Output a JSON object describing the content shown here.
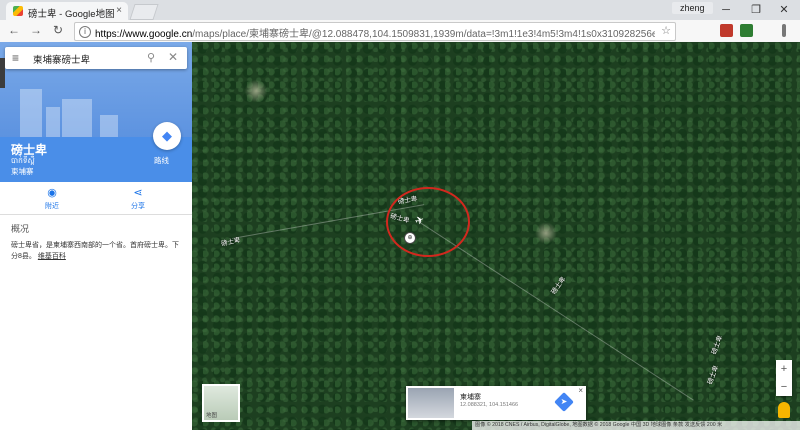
{
  "browser": {
    "tab_title": "磅士卑 - Google地图",
    "tab_close": "×",
    "user": "zheng",
    "win_min": "─",
    "win_max": "❐",
    "win_close": "✕",
    "nav_back": "←",
    "nav_forward": "→",
    "nav_reload": "↻",
    "url_scheme_host": "https://www.google.cn",
    "url_rest": "/maps/place/柬埔寨磅士卑/@12.088478,104.1509831,1939m/data=!3m1!1e3!4m5!3m4!1s0x310928256ebe44a9:0x...",
    "info_icon": "i",
    "star_icon": "☆",
    "ext_colors": [
      "#c0392b",
      "#2e7d32",
      "#777777"
    ]
  },
  "panel": {
    "search_query": "柬埔寨磅士卑",
    "menu_icon": "≡",
    "search_icon": "⚲",
    "clear_icon": "✕",
    "place_name": "磅士卑",
    "place_khmer": "បាក់ទីស្ពឺ",
    "place_country": "柬埔寨",
    "directions_icon": "◆",
    "directions_label": "路线",
    "actions": [
      {
        "icon": "◉",
        "label": "附近"
      },
      {
        "icon": "⋖",
        "label": "分享"
      }
    ],
    "section_heading": "概况",
    "description": "磅士卑省，是柬埔寨西南部的一个省。首府磅士卑。下分8县。",
    "description_link": "维基百科",
    "collapse_icon": "◂"
  },
  "map": {
    "labels": [
      {
        "text": "磅士卑"
      },
      {
        "text": "磅士卑"
      },
      {
        "text": "磅士卑"
      },
      {
        "text": "磅士卑"
      },
      {
        "text": "磅士卑"
      },
      {
        "text": "磅士卑"
      }
    ],
    "pin_icon": "⊕",
    "plane_icon": "✈",
    "minimap_label": "地图",
    "card": {
      "title": "柬埔寨",
      "coords": "12.088321, 104.151466",
      "directions_icon": "➤",
      "close_icon": "×"
    },
    "zoom_in": "+",
    "zoom_out": "−",
    "footer": "图像 © 2018 CNES / Airbus, DigitalGlobe, 地图数据 © 2018 Google   中国   3D 地球图像   条款   发送反馈   200 米"
  }
}
